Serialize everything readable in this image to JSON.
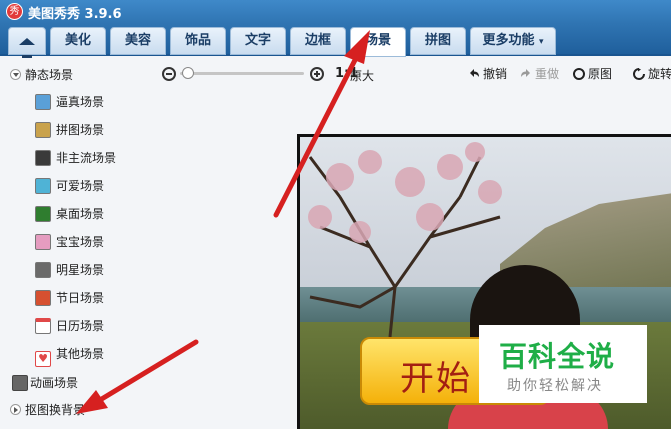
{
  "app": {
    "logo_glyph": "秀",
    "title": "美图秀秀 3.9.6"
  },
  "tabs": [
    {
      "label": "",
      "icon": "home-icon"
    },
    {
      "label": "美化"
    },
    {
      "label": "美容"
    },
    {
      "label": "饰品"
    },
    {
      "label": "文字"
    },
    {
      "label": "边框"
    },
    {
      "label": "场景",
      "active": true
    },
    {
      "label": "拼图"
    },
    {
      "label": "更多功能"
    }
  ],
  "more_caret": "▾",
  "sidebar": {
    "static_group": "静态场景",
    "items": [
      {
        "label": "逼真场景",
        "thumb_color": "#5aa0d8"
      },
      {
        "label": "拼图场景",
        "thumb_color": "#c9a24c"
      },
      {
        "label": "非主流场景",
        "thumb_color": "#3a3a3a"
      },
      {
        "label": "可爱场景",
        "thumb_color": "#4fb3d6"
      },
      {
        "label": "桌面场景",
        "thumb_color": "#2f7d2f"
      },
      {
        "label": "宝宝场景",
        "thumb_color": "#e59cc0"
      },
      {
        "label": "明星场景",
        "thumb_color": "#6a6a6a"
      },
      {
        "label": "节日场景",
        "thumb_color": "#d65030"
      },
      {
        "label": "日历场景",
        "thumb_color": "#e04848"
      },
      {
        "label": "其他场景",
        "thumb_color": "#e04848"
      }
    ],
    "animated_group": "动画场景",
    "cutout_group": "抠图换背景"
  },
  "toolbar": {
    "ratio": "1:1",
    "fit": "原大",
    "undo": "撤销",
    "redo": "重做",
    "original": "原图",
    "rotate": "旋转"
  },
  "canvas": {
    "start_button": "开始"
  },
  "watermark": {
    "title": "百科全说",
    "subtitle": "助你轻松解决"
  },
  "colors": {
    "titlebar": "#2f74b2",
    "arrow": "#d62020",
    "watermark_green": "#1fae47"
  }
}
